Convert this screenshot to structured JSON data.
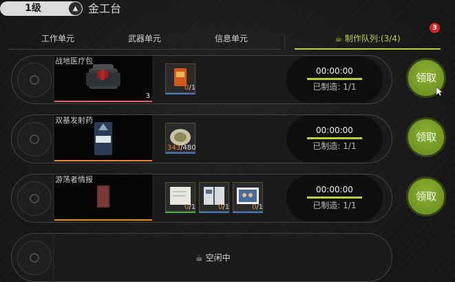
{
  "header": {
    "level": "1级",
    "station_name": "金工台"
  },
  "tabs": [
    {
      "label": "工作单元"
    },
    {
      "label": "武器单元"
    },
    {
      "label": "信息单元"
    }
  ],
  "queue_tab": {
    "label": "制作队列:(3/4)",
    "badge": "3"
  },
  "queue": [
    {
      "name": "战地医疗包",
      "count": "3",
      "rarity_color": "#e0607a",
      "materials": [
        {
          "icon": "orange-pack-icon",
          "have": "0",
          "need": "/1"
        }
      ],
      "timer": "00:00:00",
      "made": "已制造: 1/1",
      "claim_label": "领取"
    },
    {
      "name": "双基发射药",
      "count": "",
      "rarity_color": "#e88a2c",
      "materials": [
        {
          "icon": "powder-bag-icon",
          "have": "343",
          "need": "/480"
        }
      ],
      "timer": "00:00:00",
      "made": "已制造: 1/1",
      "claim_label": "领取"
    },
    {
      "name": "游荡者情报",
      "count": "",
      "rarity_color": "#e88a2c",
      "materials": [
        {
          "icon": "document-icon",
          "have": "0",
          "need": "/1"
        },
        {
          "icon": "notebook-icon",
          "have": "0",
          "need": "/1"
        },
        {
          "icon": "photo-icon",
          "have": "0",
          "need": "/1"
        }
      ],
      "timer": "00:00:00",
      "made": "已制造: 1/1",
      "claim_label": "领取"
    }
  ],
  "idle_slot": {
    "label": "空闲中"
  },
  "colors": {
    "accent": "#b6d23a",
    "badge": "#d92222",
    "claim_button": "#7fa52a",
    "material_have": "#e8862a"
  }
}
